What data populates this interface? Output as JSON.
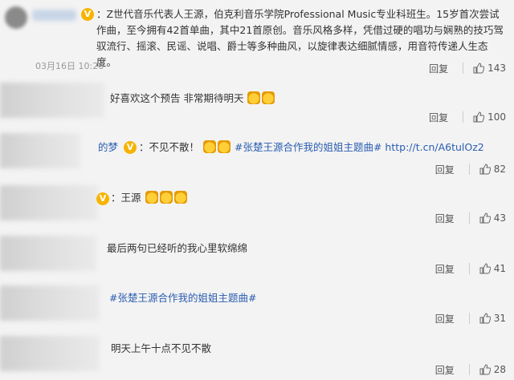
{
  "comments": [
    {
      "text": "：Z世代音乐代表人王源，伯克利音乐学院Professional Music专业科班生。15岁首次尝试作曲，至今拥有42首单曲，其中21首原创。音乐风格多样，凭借过硬的唱功与娴熟的技巧驾驭流行、摇滚、民谣、说唱、爵士等多种曲风，以旋律表达细腻情感，用音符传递人生态度。",
      "time": "03月16日 10:26",
      "reply": "回复",
      "likes": "143"
    },
    {
      "text": "好喜欢这个预告 非常期待明天",
      "reply": "回复",
      "likes": "100"
    },
    {
      "name_tail": "的梦",
      "text": "：不见不散！",
      "link": "#张楚王源合作我的姐姐主题曲# http://t.cn/A6tulOz2",
      "reply": "回复",
      "likes": "82"
    },
    {
      "text": "：王源",
      "reply": "回复",
      "likes": "43"
    },
    {
      "text": "最后两句已经听的我心里软绵绵",
      "reply": "回复",
      "likes": "41"
    },
    {
      "link": "#张楚王源合作我的姐姐主题曲#",
      "reply": "回复",
      "likes": "31"
    },
    {
      "text": "明天上午十点不见不散",
      "reply": "回复",
      "likes": "28"
    }
  ],
  "icons": {
    "verified": "verified-badge-icon",
    "like": "thumbs-up-icon",
    "emoji": "emoji-icon"
  },
  "colors": {
    "link": "#2a5db0",
    "verified": "#f6b400"
  }
}
